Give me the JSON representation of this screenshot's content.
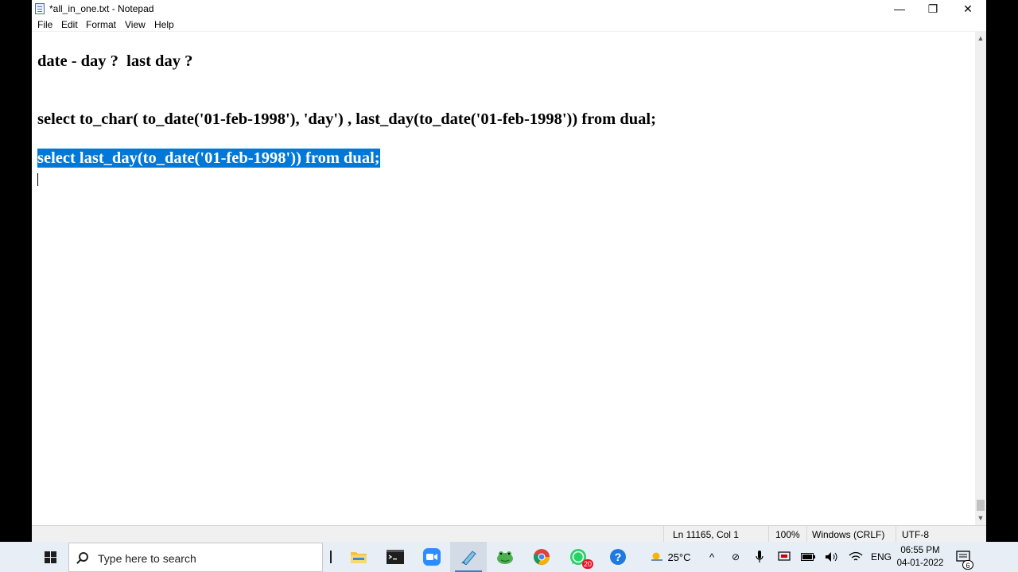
{
  "window": {
    "title": "*all_in_one.txt - Notepad",
    "controls": {
      "minimize": "—",
      "maximize": "❐",
      "close": "✕"
    }
  },
  "menu": {
    "file": "File",
    "edit": "Edit",
    "format": "Format",
    "view": "View",
    "help": "Help"
  },
  "editor": {
    "lines": [
      "date - day ?  last day ?",
      "select to_char( to_date('01-feb-1998'), 'day') , last_day(to_date('01-feb-1998')) from dual;",
      "select last_day(to_date('01-feb-1998')) from dual;"
    ],
    "selected_line_index": 2,
    "selection_color": "#0078d7"
  },
  "status": {
    "position": "Ln 11165, Col 1",
    "zoom": "100%",
    "line_ending": "Windows (CRLF)",
    "encoding": "UTF-8"
  },
  "taskbar": {
    "search_placeholder": "Type here to search",
    "apps": [
      {
        "name": "file-explorer",
        "icon": "folder-icon"
      },
      {
        "name": "terminal",
        "icon": "terminal-icon"
      },
      {
        "name": "zoom",
        "icon": "video-camera-icon"
      },
      {
        "name": "notepad",
        "icon": "notepad-icon",
        "active": true
      },
      {
        "name": "toad",
        "icon": "frog-icon"
      },
      {
        "name": "chrome",
        "icon": "chrome-icon"
      },
      {
        "name": "whatsapp",
        "icon": "whatsapp-icon",
        "badge": "20"
      },
      {
        "name": "help",
        "icon": "help-icon"
      }
    ],
    "weather": "25°C",
    "language": "ENG",
    "time": "06:55 PM",
    "date": "04-01-2022",
    "notification_count": "6"
  }
}
